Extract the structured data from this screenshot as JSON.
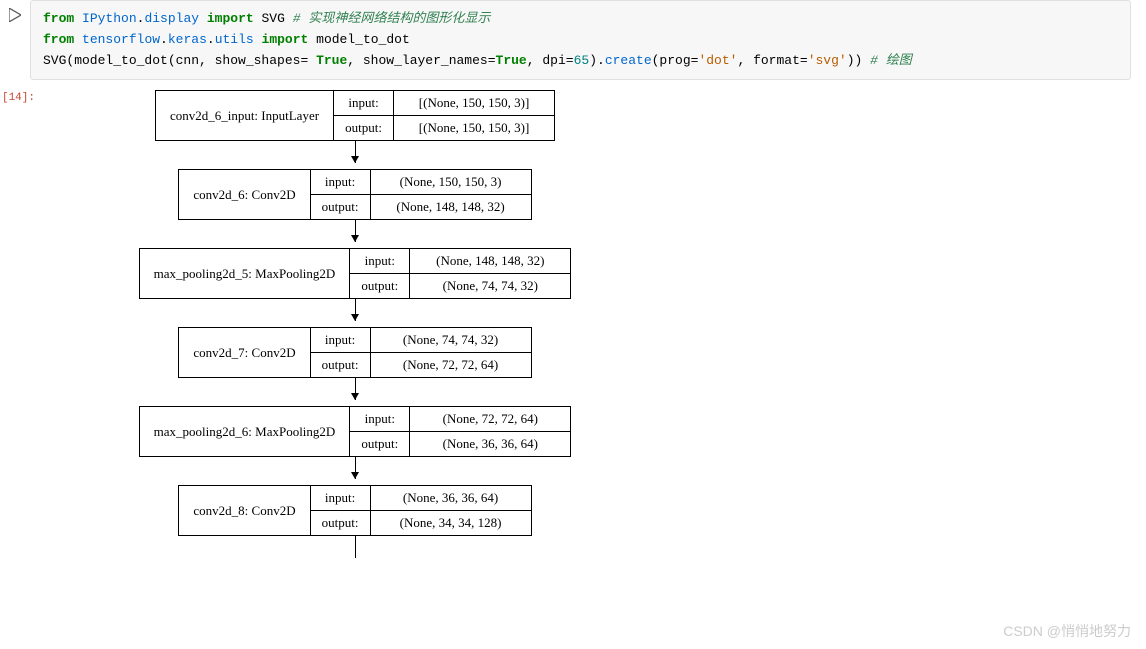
{
  "code": {
    "line1": {
      "from": "from",
      "mod1": "IPython",
      "dot1": ".",
      "mod2": "display",
      "import": "import",
      "item": "SVG",
      "comment": "# 实现神经网络结构的图形化显示"
    },
    "line2": {
      "from": "from",
      "mod1": "tensorflow",
      "dot1": ".",
      "mod2": "keras",
      "dot2": ".",
      "mod3": "utils",
      "import": "import",
      "item": "model_to_dot"
    },
    "line3": {
      "p1": "SVG(model_to_dot(cnn, show_shapes",
      "eq1": "= ",
      "true1": "True",
      "p2": ", show_layer_names",
      "eq2": "=",
      "true2": "True",
      "p3": ", dpi",
      "eq3": "=",
      "num": "65",
      "p4": ")",
      "dot": ".",
      "create": "create",
      "p5": "(prog",
      "eq4": "=",
      "str1": "'dot'",
      "p6": ", format",
      "eq5": "=",
      "str2": "'svg'",
      "p7": ")) ",
      "comment": "# 绘图"
    }
  },
  "output_label": "[14]:",
  "io_labels": {
    "input": "input:",
    "output": "output:"
  },
  "nodes": [
    {
      "label": "conv2d_6_input: InputLayer",
      "input": "[(None, 150, 150, 3)]",
      "output": "[(None, 150, 150, 3)]"
    },
    {
      "label": "conv2d_6: Conv2D",
      "input": "(None, 150, 150, 3)",
      "output": "(None, 148, 148, 32)"
    },
    {
      "label": "max_pooling2d_5: MaxPooling2D",
      "input": "(None, 148, 148, 32)",
      "output": "(None, 74, 74, 32)"
    },
    {
      "label": "conv2d_7: Conv2D",
      "input": "(None, 74, 74, 32)",
      "output": "(None, 72, 72, 64)"
    },
    {
      "label": "max_pooling2d_6: MaxPooling2D",
      "input": "(None, 72, 72, 64)",
      "output": "(None, 36, 36, 64)"
    },
    {
      "label": "conv2d_8: Conv2D",
      "input": "(None, 36, 36, 64)",
      "output": "(None, 34, 34, 128)"
    }
  ],
  "watermark": "CSDN @悄悄地努力"
}
